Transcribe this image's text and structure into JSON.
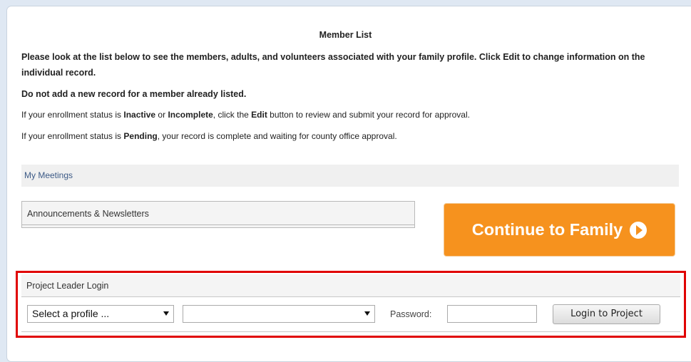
{
  "member_list": {
    "title": "Member List",
    "intro": "Please look at the list below to see the members, adults, and volunteers associated with your family profile. Click Edit to change information on the individual record.",
    "warning": "Do not add a new record for a member already listed.",
    "status_line_1": {
      "prefix": "If your enrollment status is ",
      "inactive": "Inactive",
      "or": " or ",
      "incomplete": "Incomplete",
      "mid": ", click the ",
      "edit": "Edit",
      "suffix": " button to review and submit your record for approval."
    },
    "status_line_2": {
      "prefix": "If your enrollment status is ",
      "pending": "Pending",
      "suffix": ", your record is complete and waiting for county office approval."
    }
  },
  "my_meetings": "My Meetings",
  "announcements": "Announcements & Newsletters",
  "continue_button": "Continue to Family",
  "project_leader": {
    "header": "Project Leader Login",
    "profile_select": "Select a profile ...",
    "project_select": "",
    "password_label": "Password:",
    "password_value": "",
    "login_button": "Login to Project"
  },
  "colors": {
    "accent_orange": "#f6921e",
    "highlight_red": "#e00000",
    "link_blue": "#3c5a86"
  }
}
